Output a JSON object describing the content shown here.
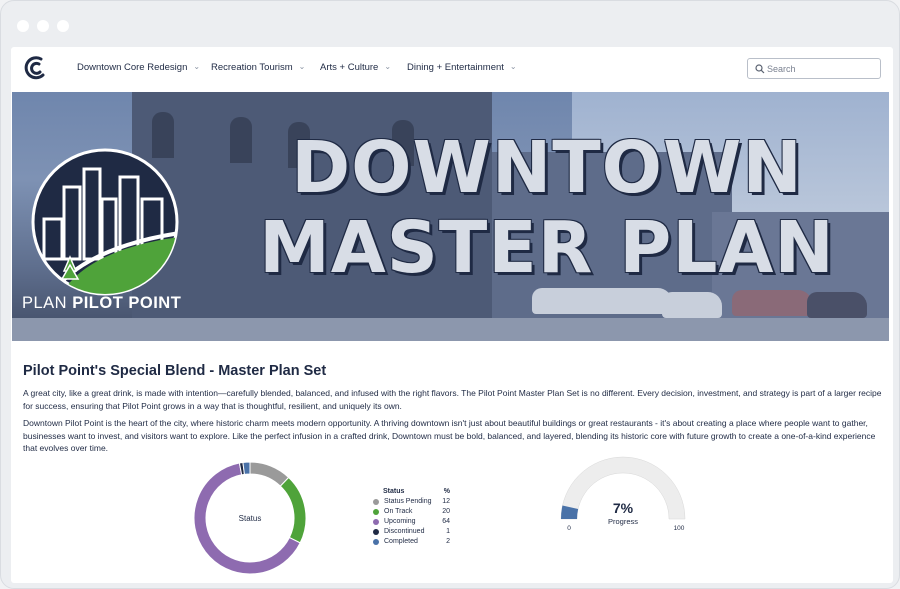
{
  "nav": {
    "items": [
      {
        "label": "Downtown Core Redesign"
      },
      {
        "label": "Recreation Tourism"
      },
      {
        "label": "Arts + Culture"
      },
      {
        "label": "Dining + Entertainment"
      }
    ],
    "search_placeholder": "Search"
  },
  "hero": {
    "title_line1": "DOWNTOWN",
    "title_line2": "MASTER PLAN",
    "emblem_word1": "PLAN",
    "emblem_word2": "PILOT POINT"
  },
  "main": {
    "heading": "Pilot Point's Special Blend - Master Plan Set",
    "para1": "A great city, like a great drink, is made with intention—carefully blended, balanced, and infused with the right flavors. The Pilot Point Master Plan Set is no different. Every decision, investment, and strategy is part of a larger recipe for success, ensuring that Pilot Point grows in a way that is thoughtful, resilient, and uniquely its own.",
    "para2": "Downtown Pilot Point is the heart of the city, where historic charm meets modern opportunity. A thriving downtown isn't just about beautiful buildings or great restaurants - it's about creating a place where people want to gather, businesses want to invest, and visitors want to explore. Like the perfect infusion in a crafted drink, Downtown must be bold, balanced, and layered, blending its historic core with future growth to create a one-of-a-kind experience that evolves over time."
  },
  "chart_data": [
    {
      "type": "pie",
      "title": "",
      "center_label": "Status",
      "legend_header": {
        "label": "Status",
        "value": "%"
      },
      "categories": [
        "Status Pending",
        "On Track",
        "Upcoming",
        "Discontinued",
        "Completed"
      ],
      "values": [
        12,
        20,
        64,
        1,
        2
      ],
      "colors": [
        "#9a9a9a",
        "#4fa33a",
        "#8e6bb0",
        "#1f2a44",
        "#4a72a8"
      ]
    },
    {
      "type": "gauge",
      "value": 7,
      "value_label": "7%",
      "label": "Progress",
      "min": 0,
      "max": 100,
      "min_label": "0",
      "max_label": "100",
      "fill_color": "#4a72a8",
      "track_color": "#ededed"
    }
  ],
  "colors": {
    "navy": "#1f2a44",
    "green": "#4fa33a"
  }
}
